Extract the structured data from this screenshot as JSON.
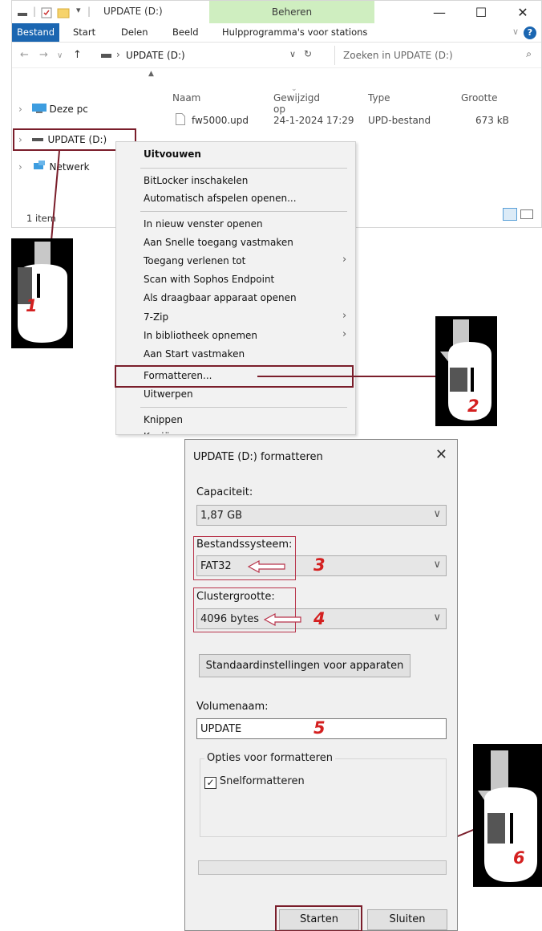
{
  "explorer": {
    "title": "UPDATE (D:)",
    "context_tab": "Beheren",
    "ribbon_tabs": [
      "Bestand",
      "Start",
      "Delen",
      "Beeld",
      "Hulpprogramma's voor stations"
    ],
    "address": "UPDATE (D:)",
    "search_placeholder": "Zoeken in UPDATE (D:)",
    "nav_items": [
      "Deze pc",
      "UPDATE (D:)",
      "Netwerk"
    ],
    "columns": [
      "Naam",
      "Gewijzigd op",
      "Type",
      "Grootte"
    ],
    "file": {
      "name": "fw5000.upd",
      "modified": "24-1-2024 17:29",
      "type": "UPD-bestand",
      "size": "673 kB"
    },
    "status": "1 item"
  },
  "context_menu": {
    "items": [
      "Uitvouwen",
      "BitLocker inschakelen",
      "Automatisch afspelen openen...",
      "In nieuw venster openen",
      "Aan Snelle toegang vastmaken",
      "Toegang verlenen tot",
      "Scan with Sophos Endpoint",
      "Als draagbaar apparaat openen",
      "7-Zip",
      "In bibliotheek opnemen",
      "Aan Start vastmaken",
      "Formatteren...",
      "Uitwerpen",
      "Knippen",
      "Kopiëren"
    ]
  },
  "dialog": {
    "title": "UPDATE (D:) formatteren",
    "capacity_label": "Capaciteit:",
    "capacity_value": "1,87 GB",
    "fs_label": "Bestandssysteem:",
    "fs_value": "FAT32",
    "cluster_label": "Clustergrootte:",
    "cluster_value": "4096 bytes",
    "defaults_button": "Standaardinstellingen voor apparaten",
    "volume_label": "Volumenaam:",
    "volume_value": "UPDATE",
    "options_group": "Opties voor formatteren",
    "quick_format": "Snelformatteren",
    "quick_format_checked": true,
    "start_button": "Starten",
    "close_button": "Sluiten",
    "progress_fraction": 0
  },
  "steps": [
    "1",
    "2",
    "3",
    "4",
    "5",
    "6"
  ],
  "colors": {
    "highlight_box": "#7a1e2b",
    "step_number": "#d42020",
    "ribbon_active": "#1b66b1",
    "context_tab": "#cfeec0"
  }
}
